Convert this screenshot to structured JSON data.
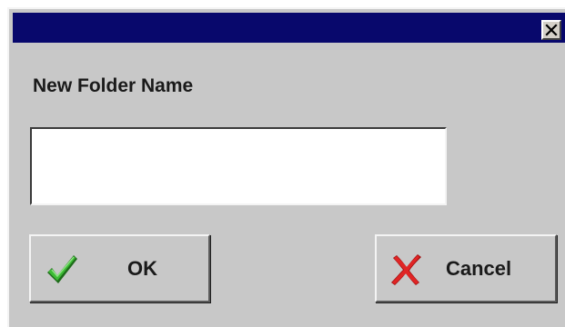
{
  "dialog": {
    "title": "",
    "prompt_label": "New Folder Name",
    "folder_name_value": "",
    "ok_label": "OK",
    "cancel_label": "Cancel",
    "close_icon": "close-icon",
    "ok_icon": "checkmark-icon",
    "cancel_icon": "cross-icon"
  },
  "colors": {
    "titlebar": "#08086c",
    "dialog_bg": "#c8c8c8",
    "checkmark": "#2f9a2a",
    "cross": "#d01818"
  }
}
